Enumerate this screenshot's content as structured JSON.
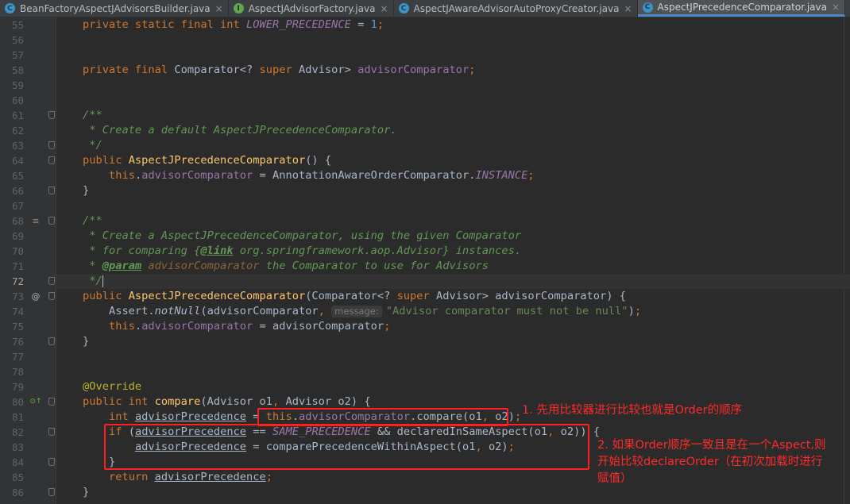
{
  "tabs": [
    {
      "label": "BeanFactoryAspectJAdvisorsBuilder.java",
      "icon": "c",
      "close": "×",
      "active": false
    },
    {
      "label": "AspectJAdvisorFactory.java",
      "icon": "i",
      "close": "×",
      "active": false
    },
    {
      "label": "AspectJAwareAdvisorAutoProxyCreator.java",
      "icon": "c",
      "close": "×",
      "active": false
    },
    {
      "label": "AspectJPrecedenceComparator.java",
      "icon": "c",
      "close": "×",
      "active": true
    },
    {
      "label": "",
      "icon": "c",
      "close": "",
      "active": false
    }
  ],
  "editor": {
    "current_line": "72",
    "lines": [
      {
        "n": "55",
        "segs": [
          [
            "k",
            "private static final int "
          ],
          [
            "fi",
            "LOWER_PRECEDENCE"
          ],
          [
            "p",
            " = "
          ],
          [
            "num",
            "1"
          ],
          [
            "k",
            ";"
          ]
        ]
      },
      {
        "n": "56",
        "segs": []
      },
      {
        "n": "57",
        "segs": []
      },
      {
        "n": "58",
        "segs": [
          [
            "k",
            "private final "
          ],
          [
            "p",
            "Comparator<? "
          ],
          [
            "k",
            "super "
          ],
          [
            "p",
            "Advisor> "
          ],
          [
            "f",
            "advisorComparator"
          ],
          [
            "k",
            ";"
          ]
        ]
      },
      {
        "n": "59",
        "segs": []
      },
      {
        "n": "60",
        "segs": []
      },
      {
        "n": "61",
        "fold": true,
        "segs": [
          [
            "doc",
            "/**"
          ]
        ]
      },
      {
        "n": "62",
        "segs": [
          [
            "doc",
            " * Create a default AspectJPrecedenceComparator."
          ]
        ]
      },
      {
        "n": "63",
        "fold": true,
        "segs": [
          [
            "doc",
            " */"
          ]
        ]
      },
      {
        "n": "64",
        "fold": true,
        "segs": [
          [
            "k",
            "public "
          ],
          [
            "fn",
            "AspectJPrecedenceComparator"
          ],
          [
            "p",
            "() {"
          ]
        ]
      },
      {
        "n": "65",
        "segs": [
          [
            "p",
            "    "
          ],
          [
            "k",
            "this"
          ],
          [
            "p",
            "."
          ],
          [
            "f",
            "advisorComparator"
          ],
          [
            "p",
            " = AnnotationAwareOrderComparator."
          ],
          [
            "fi",
            "INSTANCE"
          ],
          [
            "k",
            ";"
          ]
        ]
      },
      {
        "n": "66",
        "fold": true,
        "segs": [
          [
            "p",
            "}"
          ]
        ]
      },
      {
        "n": "67",
        "segs": []
      },
      {
        "n": "68",
        "gicon": "≡",
        "fold": true,
        "segs": [
          [
            "doc",
            "/**"
          ]
        ]
      },
      {
        "n": "69",
        "segs": [
          [
            "doc",
            " * Create a AspectJPrecedenceComparator, using the given Comparator"
          ]
        ]
      },
      {
        "n": "70",
        "segs": [
          [
            "doc",
            " * for comparing {"
          ],
          [
            "tag",
            "@link"
          ],
          [
            "doc",
            " org.springframework.aop.Advisor} instances."
          ]
        ]
      },
      {
        "n": "71",
        "segs": [
          [
            "doc",
            " * "
          ],
          [
            "tag",
            "@param"
          ],
          [
            "tagv",
            " advisorComparator"
          ],
          [
            "doc",
            " the Comparator to use for Advisors"
          ]
        ]
      },
      {
        "n": "72",
        "fold": true,
        "cursor": true,
        "segs": [
          [
            "doc",
            " */"
          ]
        ]
      },
      {
        "n": "73",
        "gicon": "@",
        "fold": true,
        "segs": [
          [
            "k",
            "public "
          ],
          [
            "fn",
            "AspectJPrecedenceComparator"
          ],
          [
            "p",
            "(Comparator<? "
          ],
          [
            "k",
            "super "
          ],
          [
            "p",
            "Advisor> advisorComparator) {"
          ]
        ]
      },
      {
        "n": "74",
        "segs": [
          [
            "p",
            "    Assert."
          ],
          [
            "ital",
            "notNull"
          ],
          [
            "p",
            "(advisorComparator"
          ],
          [
            "k",
            ", "
          ],
          [
            "hint",
            "message:"
          ],
          [
            "str",
            "\"Advisor comparator must not be null\""
          ],
          [
            "p",
            ")"
          ],
          [
            "k",
            ";"
          ]
        ]
      },
      {
        "n": "75",
        "segs": [
          [
            "p",
            "    "
          ],
          [
            "k",
            "this"
          ],
          [
            "p",
            "."
          ],
          [
            "f",
            "advisorComparator"
          ],
          [
            "p",
            " = advisorComparator"
          ],
          [
            "k",
            ";"
          ]
        ]
      },
      {
        "n": "76",
        "fold": true,
        "segs": [
          [
            "p",
            "}"
          ]
        ]
      },
      {
        "n": "77",
        "segs": []
      },
      {
        "n": "78",
        "segs": []
      },
      {
        "n": "79",
        "segs": [
          [
            "ann",
            "@Override"
          ]
        ]
      },
      {
        "n": "80",
        "gicon": "⊙↑",
        "fold": true,
        "segs": [
          [
            "k",
            "public int "
          ],
          [
            "fn",
            "compare"
          ],
          [
            "p",
            "(Advisor o1"
          ],
          [
            "k",
            ", "
          ],
          [
            "p",
            "Advisor o2) {"
          ]
        ]
      },
      {
        "n": "81",
        "segs": [
          [
            "p",
            "    "
          ],
          [
            "k",
            "int "
          ],
          [
            "ul",
            "advisorPrecedence"
          ],
          [
            "p",
            " = "
          ],
          [
            "k",
            "this"
          ],
          [
            "p",
            "."
          ],
          [
            "f",
            "advisorComparator"
          ],
          [
            "p",
            ".compare(o1"
          ],
          [
            "k",
            ", "
          ],
          [
            "p",
            "o2)"
          ],
          [
            "k",
            ";"
          ]
        ]
      },
      {
        "n": "82",
        "fold": true,
        "segs": [
          [
            "p",
            "    "
          ],
          [
            "k",
            "if "
          ],
          [
            "p",
            "("
          ],
          [
            "ul",
            "advisorPrecedence"
          ],
          [
            "p",
            " == "
          ],
          [
            "fi",
            "SAME_PRECEDENCE"
          ],
          [
            "p",
            " && declaredInSameAspect(o1"
          ],
          [
            "k",
            ", "
          ],
          [
            "p",
            "o2)) {"
          ]
        ]
      },
      {
        "n": "83",
        "segs": [
          [
            "p",
            "        "
          ],
          [
            "ul",
            "advisorPrecedence"
          ],
          [
            "p",
            " = comparePrecedenceWithinAspect(o1"
          ],
          [
            "k",
            ", "
          ],
          [
            "p",
            "o2)"
          ],
          [
            "k",
            ";"
          ]
        ]
      },
      {
        "n": "84",
        "fold": true,
        "segs": [
          [
            "p",
            "    }"
          ]
        ]
      },
      {
        "n": "85",
        "segs": [
          [
            "p",
            "    "
          ],
          [
            "k",
            "return "
          ],
          [
            "ul",
            "advisorPrecedence"
          ],
          [
            "k",
            ";"
          ]
        ]
      },
      {
        "n": "86",
        "fold": true,
        "segs": [
          [
            "p",
            "}"
          ]
        ]
      }
    ]
  },
  "annotations": {
    "note1": "1. 先用比较器进行比较也就是Order的顺序",
    "note2_line1": "2. 如果Order顺序一致且是在一个Aspect,则",
    "note2_line2": "开始比较declareOrder（在初次加载时进行",
    "note2_line3": "赋值）",
    "highlight_color": "#ff1f1f"
  }
}
